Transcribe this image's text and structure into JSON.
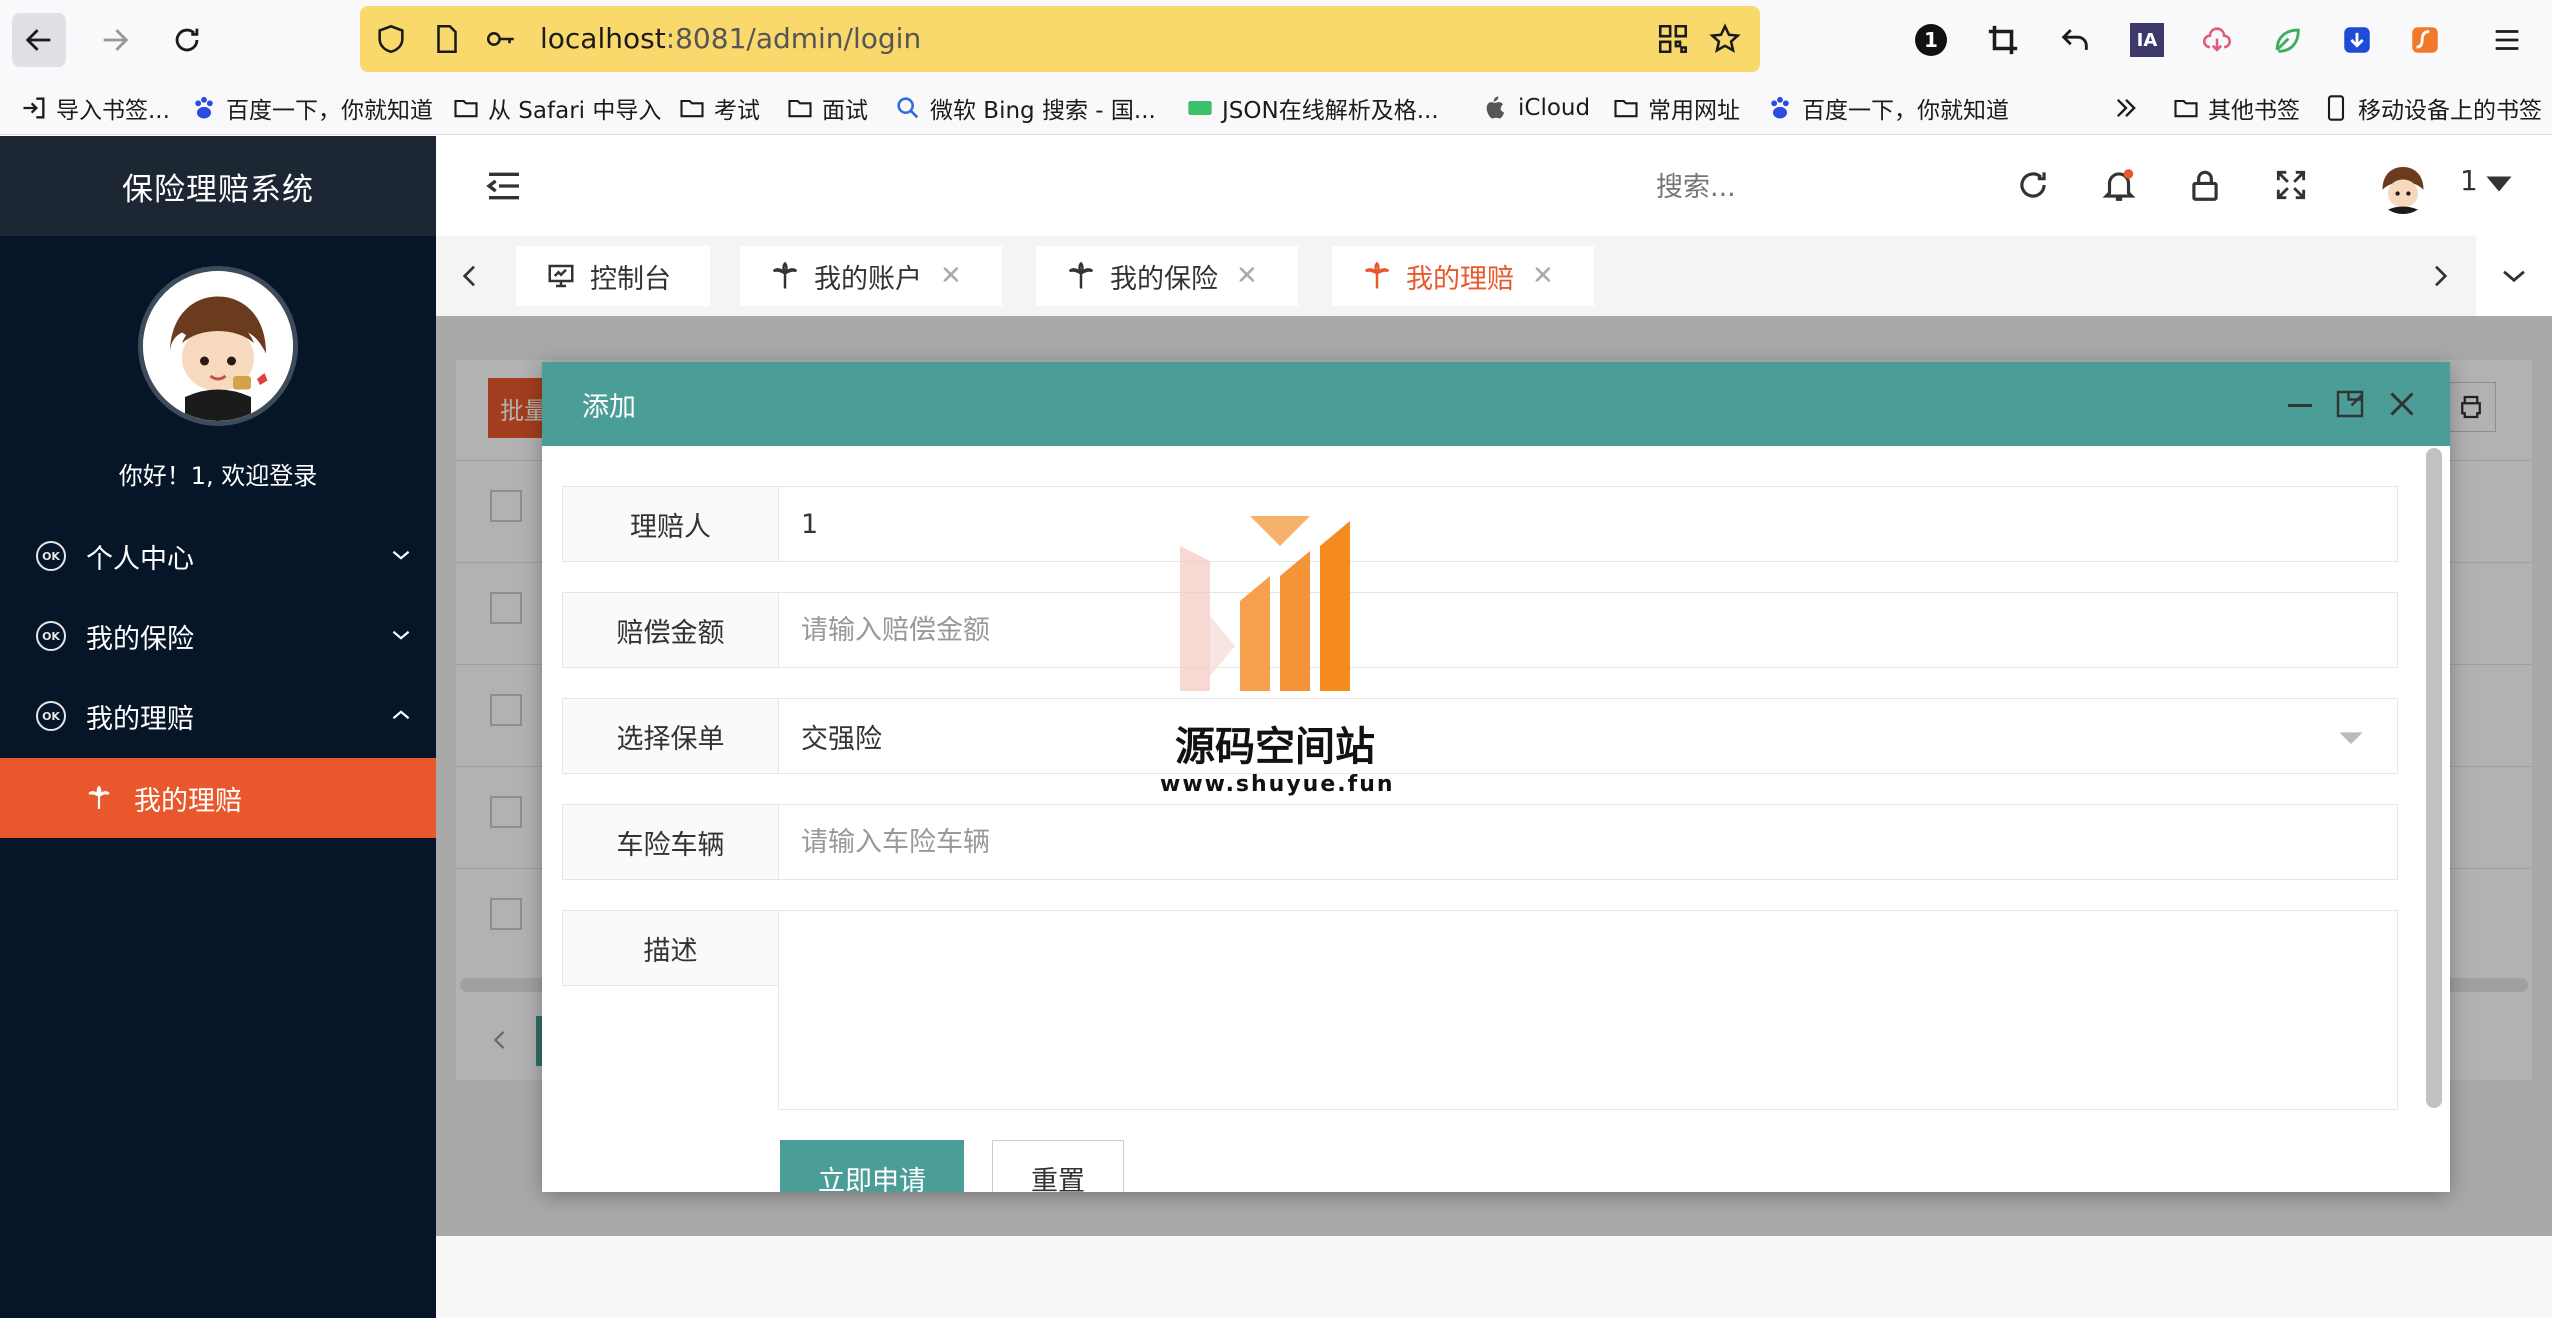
{
  "browser": {
    "url_host": "localhost",
    "url_rest": ":8081/admin/login",
    "bookmarks": [
      {
        "label": "导入书签...",
        "icon": "import-icon"
      },
      {
        "label": "百度一下，你就知道",
        "icon": "baidu-icon"
      },
      {
        "label": "从 Safari 中导入",
        "icon": "folder-icon"
      },
      {
        "label": "考试",
        "icon": "folder-icon"
      },
      {
        "label": "面试",
        "icon": "folder-icon"
      },
      {
        "label": "微软 Bing 搜索 - 国...",
        "icon": "search-icon"
      },
      {
        "label": "JSON在线解析及格...",
        "icon": "json-icon"
      },
      {
        "label": "iCloud",
        "icon": "apple-icon"
      },
      {
        "label": "常用网址",
        "icon": "folder-icon"
      },
      {
        "label": "百度一下，你就知道",
        "icon": "baidu-icon"
      }
    ],
    "other_bookmarks": "其他书签",
    "mobile_bookmarks": "移动设备上的书签",
    "extension_badge": "1",
    "extension_ia": "IA"
  },
  "sidebar": {
    "app_title": "保险理赔系统",
    "welcome": "你好！1, 欢迎登录",
    "menu": [
      {
        "label": "个人中心",
        "icon": "ok-icon",
        "expanded": false
      },
      {
        "label": "我的保险",
        "icon": "ok-icon",
        "expanded": false
      },
      {
        "label": "我的理赔",
        "icon": "ok-icon",
        "expanded": true
      }
    ],
    "submenu_active": "我的理赔"
  },
  "header": {
    "search_placeholder": "搜索...",
    "username": "1"
  },
  "tabs": [
    {
      "label": "控制台",
      "icon": "monitor-icon",
      "closable": false
    },
    {
      "label": "我的账户",
      "icon": "palm-icon",
      "closable": true
    },
    {
      "label": "我的保险",
      "icon": "palm-icon",
      "closable": true
    },
    {
      "label": "我的理赔",
      "icon": "palm-icon",
      "closable": true,
      "active": true
    }
  ],
  "background": {
    "batch_button": "批量"
  },
  "modal": {
    "title": "添加",
    "fields": {
      "claimant": {
        "label": "理赔人",
        "value": "1"
      },
      "amount": {
        "label": "赔偿金额",
        "placeholder": "请输入赔偿金额"
      },
      "policy": {
        "label": "选择保单",
        "value": "交强险"
      },
      "vehicle": {
        "label": "车险车辆",
        "placeholder": "请输入车险车辆"
      },
      "description": {
        "label": "描述",
        "value": ""
      }
    },
    "submit_label": "立即申请",
    "reset_label": "重置"
  },
  "watermark": {
    "title": "源码空间站",
    "url": "www.shuyue.fun"
  },
  "colors": {
    "sidebar_bg": "#061628",
    "accent_orange": "#e8582c",
    "modal_header": "#4a9e97",
    "url_bar": "#f9d96c"
  }
}
